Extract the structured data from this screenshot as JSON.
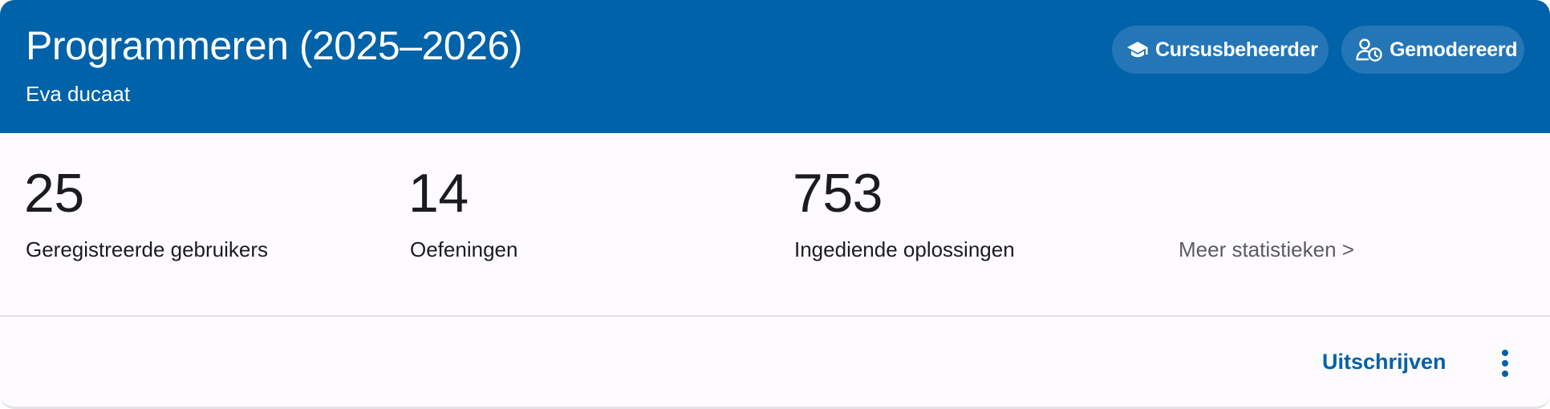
{
  "course": {
    "title": "Programmeren (2025–2026)",
    "teacher": "Eva ducaat"
  },
  "badges": [
    {
      "label": "Cursusbeheerder",
      "icon": "graduation-cap-icon"
    },
    {
      "label": "Gemodereerd",
      "icon": "user-clock-icon"
    }
  ],
  "stats": [
    {
      "value": "25",
      "label": "Geregistreerde gebruikers"
    },
    {
      "value": "14",
      "label": "Oefeningen"
    },
    {
      "value": "753",
      "label": "Ingediende oplossingen"
    }
  ],
  "more_stats_link": "Meer statistieken >",
  "actions": {
    "unsubscribe_label": "Uitschrijven",
    "menu_icon": "more-vert-icon"
  },
  "colors": {
    "header_background": "#0062a8",
    "chip_background": "#2476b6",
    "link_color": "#0062a8",
    "text_primary": "#1c1b1f",
    "text_secondary": "#5c5b60"
  }
}
